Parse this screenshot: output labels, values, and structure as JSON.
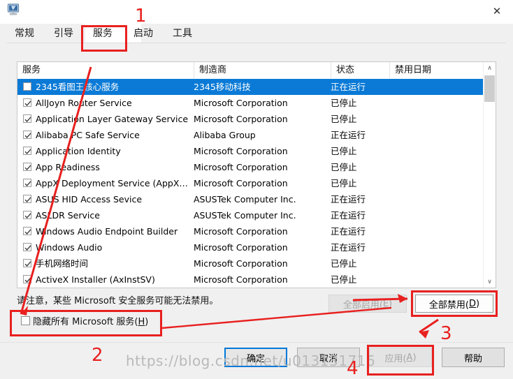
{
  "window": {
    "icon": "computer-monitor-icon",
    "close_label": "✕"
  },
  "tabs": [
    {
      "label": "常规",
      "active": false
    },
    {
      "label": "引导",
      "active": false
    },
    {
      "label": "服务",
      "active": true
    },
    {
      "label": "启动",
      "active": false
    },
    {
      "label": "工具",
      "active": false
    }
  ],
  "list": {
    "columns": [
      {
        "label": "服务"
      },
      {
        "label": "制造商"
      },
      {
        "label": "状态"
      },
      {
        "label": "禁用日期"
      }
    ],
    "rows": [
      {
        "checked": true,
        "selected": true,
        "name": "2345看图王核心服务",
        "manufacturer": "2345移动科技",
        "status": "正在运行",
        "disabled_date": ""
      },
      {
        "checked": true,
        "selected": false,
        "name": "AllJoyn Router Service",
        "manufacturer": "Microsoft Corporation",
        "status": "已停止",
        "disabled_date": ""
      },
      {
        "checked": true,
        "selected": false,
        "name": "Application Layer Gateway Service",
        "manufacturer": "Microsoft Corporation",
        "status": "已停止",
        "disabled_date": ""
      },
      {
        "checked": true,
        "selected": false,
        "name": "Alibaba PC Safe Service",
        "manufacturer": "Alibaba Group",
        "status": "正在运行",
        "disabled_date": ""
      },
      {
        "checked": true,
        "selected": false,
        "name": "Application Identity",
        "manufacturer": "Microsoft Corporation",
        "status": "已停止",
        "disabled_date": ""
      },
      {
        "checked": true,
        "selected": false,
        "name": "App Readiness",
        "manufacturer": "Microsoft Corporation",
        "status": "已停止",
        "disabled_date": ""
      },
      {
        "checked": true,
        "selected": false,
        "name": "AppX Deployment Service (AppX…",
        "manufacturer": "Microsoft Corporation",
        "status": "已停止",
        "disabled_date": ""
      },
      {
        "checked": true,
        "selected": false,
        "name": "ASUS HID Access Sevice",
        "manufacturer": "ASUSTek Computer Inc.",
        "status": "正在运行",
        "disabled_date": ""
      },
      {
        "checked": true,
        "selected": false,
        "name": "ASLDR Service",
        "manufacturer": "ASUSTek Computer Inc.",
        "status": "正在运行",
        "disabled_date": ""
      },
      {
        "checked": true,
        "selected": false,
        "name": "Windows Audio Endpoint Builder",
        "manufacturer": "Microsoft Corporation",
        "status": "正在运行",
        "disabled_date": ""
      },
      {
        "checked": true,
        "selected": false,
        "name": "Windows Audio",
        "manufacturer": "Microsoft Corporation",
        "status": "正在运行",
        "disabled_date": ""
      },
      {
        "checked": true,
        "selected": false,
        "name": "手机网络时间",
        "manufacturer": "Microsoft Corporation",
        "status": "已停止",
        "disabled_date": ""
      },
      {
        "checked": true,
        "selected": false,
        "name": "ActiveX Installer (AxInstSV)",
        "manufacturer": "Microsoft Corporation",
        "status": "已停止",
        "disabled_date": ""
      }
    ],
    "scrollbar": {
      "up": "∧",
      "down": "∨"
    }
  },
  "note": "请注意，某些 Microsoft 安全服务可能无法禁用。",
  "hide_checkbox": {
    "label_before": "隐藏所有 Microsoft 服务(",
    "accel": "H",
    "label_after": ")",
    "checked": false
  },
  "mid_buttons": {
    "enable_all": {
      "text_before": "全部启用(",
      "accel": "E",
      "text_after": ")",
      "disabled": true
    },
    "disable_all": {
      "text_before": "全部禁用(",
      "accel": "D",
      "text_after": ")",
      "disabled": false
    }
  },
  "bottom_buttons": {
    "ok": {
      "label": "确定",
      "default": true
    },
    "cancel": {
      "label": "取消"
    },
    "apply": {
      "text_before": "应用(",
      "accel": "A",
      "text_after": ")",
      "disabled": true
    },
    "help": {
      "label": "帮助"
    }
  },
  "annotations": {
    "numbers": [
      "1",
      "2",
      "3",
      "4"
    ],
    "color": "#e8201f"
  },
  "watermark": "https://blog.csdn.net/u013131716"
}
